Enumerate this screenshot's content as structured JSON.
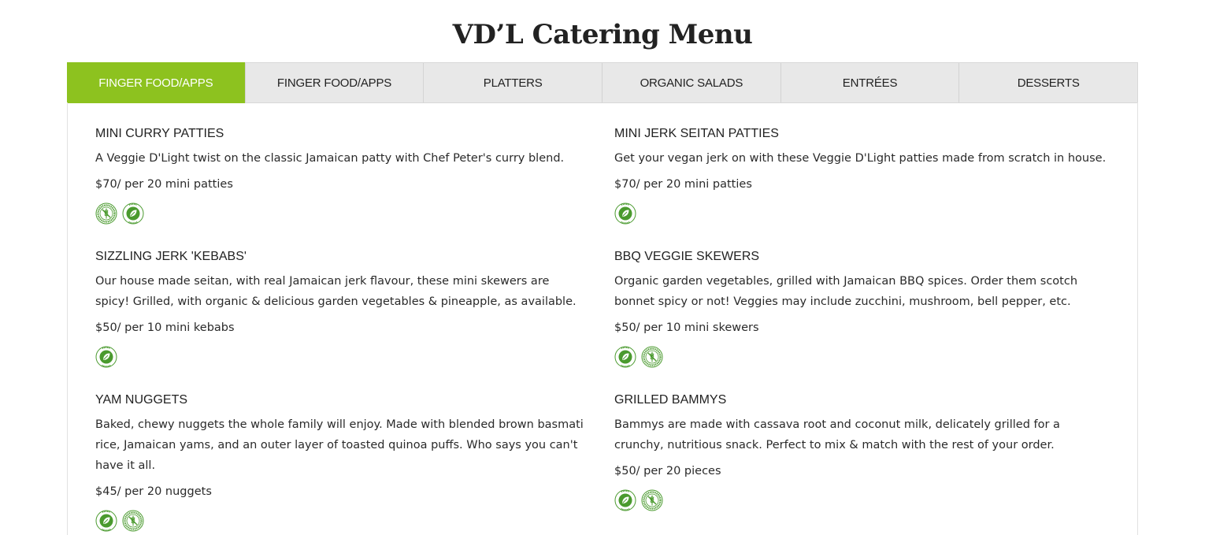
{
  "page": {
    "title": "VD’L Catering Menu"
  },
  "colors": {
    "accent": "#8dc21f",
    "badge_green": "#4a9a2e"
  },
  "tabs": [
    {
      "label": "FINGER FOOD/APPS",
      "active": true
    },
    {
      "label": "FINGER FOOD/APPS",
      "active": false
    },
    {
      "label": "PLATTERS",
      "active": false
    },
    {
      "label": "ORGANIC SALADS",
      "active": false
    },
    {
      "label": "ENTRÉES",
      "active": false
    },
    {
      "label": "DESSERTS",
      "active": false
    }
  ],
  "menu": {
    "left": [
      {
        "name": "MINI CURRY PATTIES",
        "description": "A Veggie D'Light twist on the classic Jamaican patty with Chef Peter's curry blend.",
        "price": "$70/ per 20 mini patties",
        "badges": [
          "gluten-free-badge-icon",
          "vegan-badge-icon"
        ]
      },
      {
        "name": "SIZZLING JERK 'KEBABS'",
        "description": "Our house made seitan, with real Jamaican jerk flavour, these mini skewers are spicy! Grilled, with organic & delicious garden vegetables & pineapple, as available.",
        "price": "$50/ per 10 mini kebabs",
        "badges": [
          "vegan-badge-icon"
        ]
      },
      {
        "name": "YAM NUGGETS",
        "description": "Baked, chewy nuggets the whole family will enjoy. Made with blended brown basmati rice, Jamaican yams, and an outer layer of toasted quinoa puffs. Who says you can't have it all.",
        "price": "$45/ per 20 nuggets",
        "badges": [
          "vegan-badge-icon",
          "gluten-free-badge-icon"
        ]
      }
    ],
    "right": [
      {
        "name": "MINI JERK SEITAN PATTIES",
        "description": "Get your vegan jerk on with these Veggie D'Light patties made from scratch in house.",
        "price": "$70/ per 20 mini patties",
        "badges": [
          "vegan-badge-icon"
        ]
      },
      {
        "name": "BBQ VEGGIE SKEWERS",
        "description": "Organic garden vegetables, grilled with Jamaican BBQ spices. Order them scotch bonnet spicy or not! Veggies may include zucchini, mushroom, bell pepper, etc.",
        "price": "$50/ per 10 mini skewers",
        "badges": [
          "vegan-badge-icon",
          "gluten-free-badge-icon"
        ]
      },
      {
        "name": "GRILLED BAMMYS",
        "description": "Bammys are made with cassava root and coconut milk, delicately grilled for a crunchy, nutritious snack. Perfect to mix & match with the rest of your order.",
        "price": "$50/ per 20 pieces",
        "badges": [
          "vegan-badge-icon",
          "gluten-free-badge-icon"
        ]
      }
    ]
  }
}
